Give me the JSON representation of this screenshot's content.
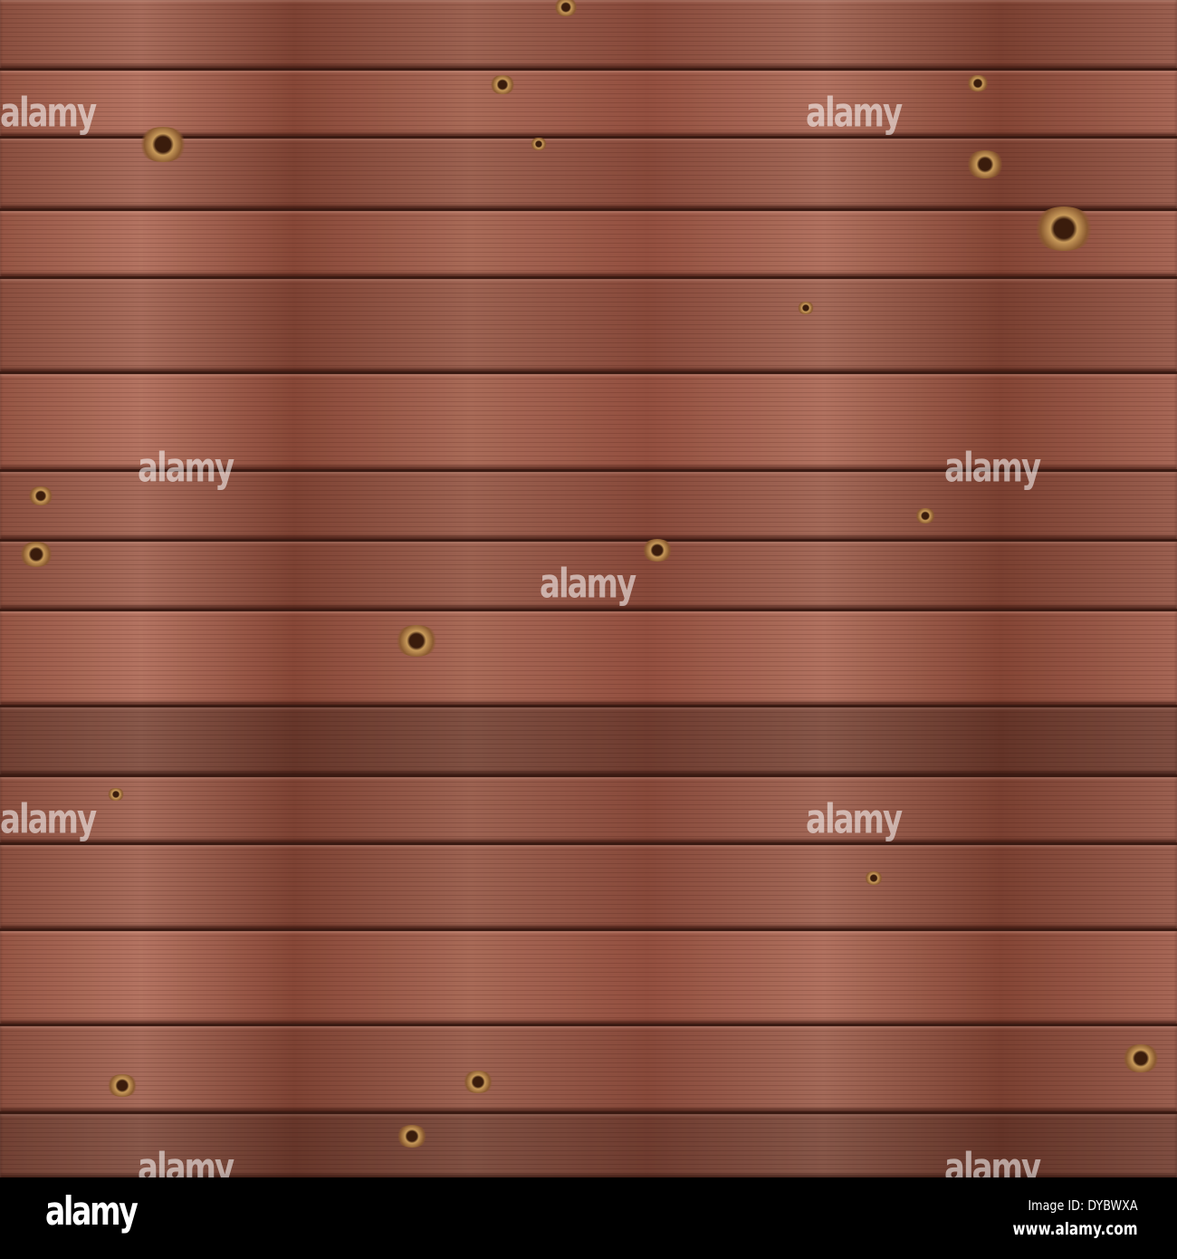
{
  "photo": {
    "subject": "brown wooden planks",
    "watermark": "alamy"
  },
  "footer": {
    "logo": "alamy",
    "image_id": "Image ID: DYBWXA",
    "website": "www.alamy.com"
  },
  "colors": {
    "wood": "#8a4f3f",
    "gap": "#3a1a12",
    "footer_bg": "#000000"
  }
}
